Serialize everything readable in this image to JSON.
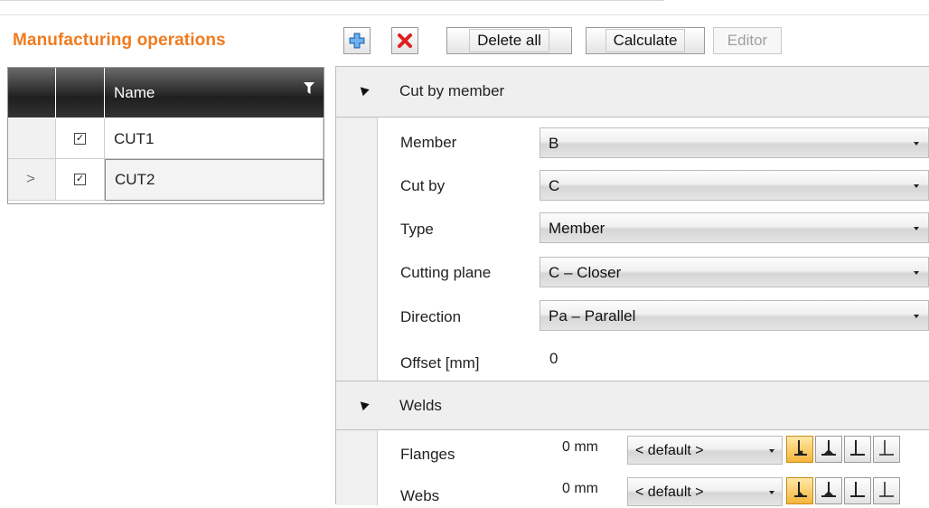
{
  "title": "Manufacturing operations",
  "toolbar": {
    "add_icon": "plus-icon",
    "remove_icon": "red-x-icon",
    "delete_all": "Delete all",
    "calculate": "Calculate",
    "editor": "Editor"
  },
  "grid": {
    "column_name": "Name",
    "filter_icon": "filter-icon",
    "rows": [
      {
        "name": "CUT1",
        "checked": true,
        "selected": false
      },
      {
        "name": "CUT2",
        "checked": true,
        "selected": true
      }
    ],
    "current_row_marker": ">"
  },
  "cut_section": {
    "title": "Cut by member",
    "fields": [
      {
        "label": "Member",
        "value": "B"
      },
      {
        "label": "Cut by",
        "value": "C"
      },
      {
        "label": "Type",
        "value": "Member"
      },
      {
        "label": "Cutting plane",
        "value": "C – Closer"
      },
      {
        "label": "Direction",
        "value": "Pa – Parallel"
      }
    ],
    "offset_label": "Offset [mm]",
    "offset_value": "0"
  },
  "welds_section": {
    "title": "Welds",
    "rows": [
      {
        "label": "Flanges",
        "size": "0 mm",
        "type": "< default >"
      },
      {
        "label": "Webs",
        "size": "0 mm",
        "type": "< default >"
      }
    ]
  },
  "colors": {
    "accent": "#f07b1e",
    "selected_weld": "#f5b53b"
  }
}
